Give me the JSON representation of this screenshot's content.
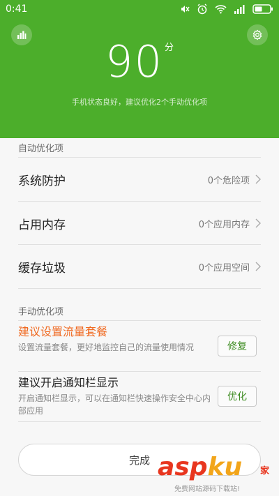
{
  "status_bar": {
    "time": "0:41"
  },
  "header": {
    "score": "90",
    "score_unit": "分",
    "summary": "手机状态良好，建议优化2个手动优化项",
    "icons": [
      "bar-chart-icon",
      "gear-icon"
    ]
  },
  "auto_section": {
    "title": "自动优化项",
    "items": [
      {
        "label": "系统防护",
        "value": "0个危险项"
      },
      {
        "label": "占用内存",
        "value": "0个应用内存"
      },
      {
        "label": "缓存垃圾",
        "value": "0个应用空间"
      }
    ]
  },
  "manual_section": {
    "title": "手动优化项",
    "items": [
      {
        "label": "建议设置流量套餐",
        "desc": "设置流量套餐，更好地监控自己的流量使用情况",
        "action": "修复"
      },
      {
        "label": "建议开启通知栏显示",
        "desc": "开启通知栏显示，可以在通知栏快速操作安全中心内部应用",
        "action": "优化"
      }
    ]
  },
  "footer": {
    "done_label": "完成"
  },
  "watermark": {
    "logo_a": "asp",
    "logo_b": "ku",
    "tag": "家",
    "sub": "免费网站源码下载站!"
  },
  "colors": {
    "header_green": "#4cae2b",
    "warn_orange": "#f06a22",
    "action_green": "#3d8c21"
  }
}
